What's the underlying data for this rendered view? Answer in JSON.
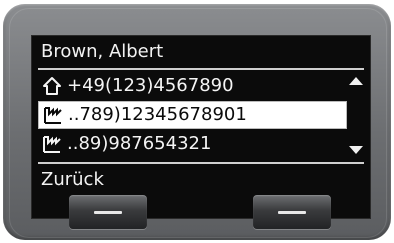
{
  "header": {
    "contact_name": "Brown, Albert"
  },
  "numbers": [
    {
      "type_icon": "home-icon",
      "number": "+49(123)4567890",
      "selected": false
    },
    {
      "type_icon": "office-icon",
      "number": "..789)12345678901",
      "selected": true
    },
    {
      "type_icon": "office-icon",
      "number": "..89)987654321",
      "selected": false
    }
  ],
  "footer": {
    "back_label": "Zurück"
  },
  "softkeys": {
    "left_icon": "minus-icon",
    "right_icon": "minus-icon"
  },
  "colors": {
    "screen_bg": "#0b0b0b",
    "text": "#f2f2f2",
    "selection_bg": "#ffffff",
    "device": "#6c6e71"
  }
}
